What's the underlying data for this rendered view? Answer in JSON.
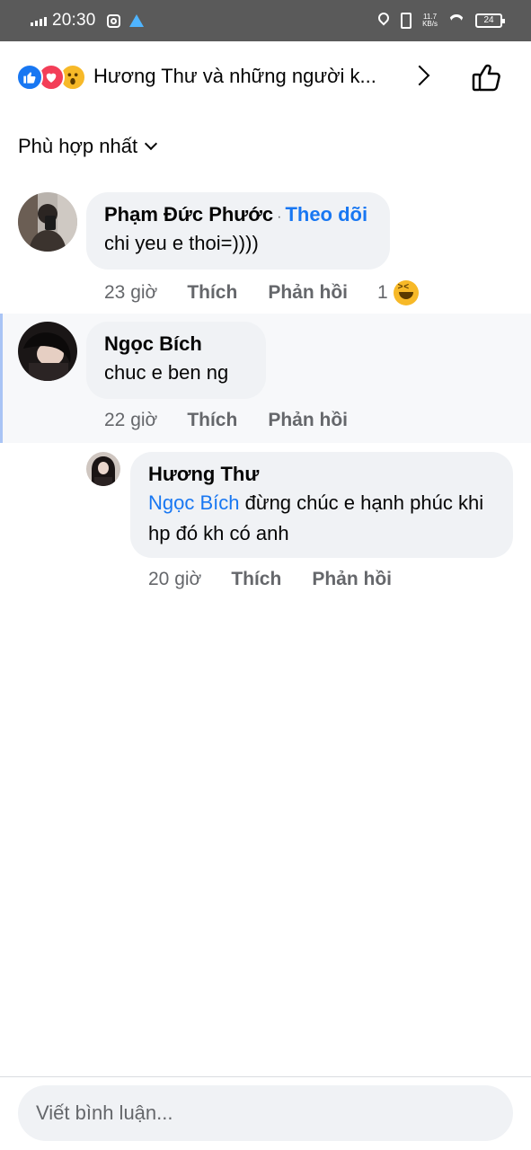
{
  "status_bar": {
    "time": "20:30",
    "network_speed": "11.7\nKB/s",
    "battery": "24",
    "icons": [
      "signal-icon",
      "instagram-icon",
      "warning-icon",
      "location-icon",
      "vibrate-icon",
      "wifi-icon",
      "battery-icon"
    ]
  },
  "header": {
    "title": "Hương Thư và những người k...",
    "reaction_icons": [
      "like-reaction-icon",
      "love-reaction-icon",
      "wow-reaction-icon"
    ]
  },
  "sort": {
    "label": "Phù hợp nhất"
  },
  "comments": [
    {
      "author": "Phạm Đức Phước",
      "follow_label": "Theo dõi",
      "separator": "·",
      "text": "chi yeu e thoi=))))",
      "time": "23 giờ",
      "like_label": "Thích",
      "reply_label": "Phản hồi",
      "reaction_count": "1",
      "reaction": "haha-icon"
    },
    {
      "author": "Ngọc Bích",
      "text": "chuc e ben ng",
      "time": "22 giờ",
      "like_label": "Thích",
      "reply_label": "Phản hồi"
    }
  ],
  "reply": {
    "author": "Hương Thư",
    "mention": "Ngọc Bích",
    "text": " đừng chúc e hạnh phúc khi hp đó kh có anh",
    "time": "20 giờ",
    "like_label": "Thích",
    "reply_label": "Phản hồi"
  },
  "composer": {
    "placeholder": "Viết bình luận..."
  },
  "colors": {
    "accent": "#1877f2",
    "bubble": "#f0f2f5",
    "meta": "#65676b",
    "status_bar": "#5a5a5a"
  }
}
